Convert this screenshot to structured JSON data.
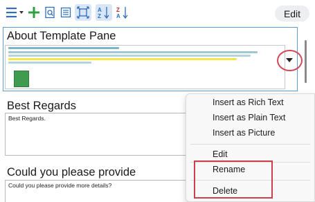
{
  "toolbar": {
    "edit_label": "Edit",
    "icons": [
      "list-menu-icon",
      "add-icon",
      "search-document-icon",
      "document-icon",
      "zoom-fit-icon",
      "sort-a-z-icon",
      "sort-z-a-icon"
    ]
  },
  "cards": [
    {
      "title": "About Template Pane",
      "body": ""
    },
    {
      "title": "Best Regards",
      "body": "Best Regards."
    },
    {
      "title": "Could you please provide",
      "body": "Could you please provide more details?"
    }
  ],
  "context_menu": {
    "items": [
      "Insert as Rich Text",
      "Insert as Plain Text",
      "Insert as Picture",
      "Edit",
      "Rename",
      "Delete"
    ]
  },
  "colors": {
    "accent_blue": "#2f6fb9",
    "add_green": "#2ea043",
    "highlight_red": "#c9404e",
    "selection_blue": "#5b9bd5"
  }
}
